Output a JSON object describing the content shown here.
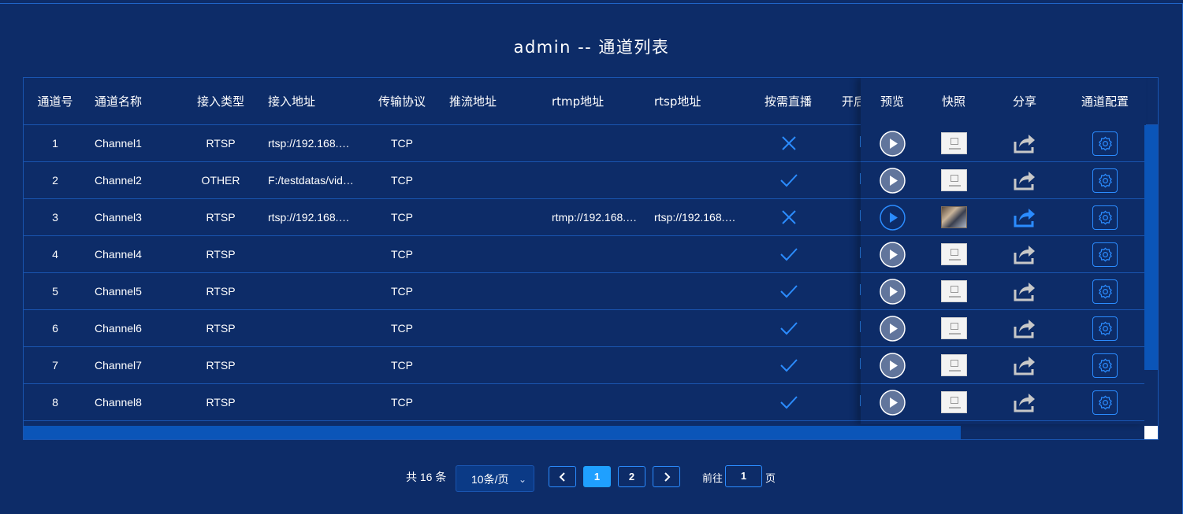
{
  "title": "admin -- 通道列表",
  "columns": {
    "channel_no": "通道号",
    "channel_name": "通道名称",
    "access_type": "接入类型",
    "access_addr": "接入地址",
    "protocol": "传输协议",
    "push_addr": "推流地址",
    "rtmp_addr": "rtmp地址",
    "rtsp_addr": "rtsp地址",
    "on_demand": "按需直播",
    "enable_partial": "开后",
    "preview": "预览",
    "snapshot": "快照",
    "share": "分享",
    "config": "通道配置"
  },
  "rows": [
    {
      "no": "1",
      "name": "Channel1",
      "type": "RTSP",
      "addr": "rtsp://192.168.…",
      "proto": "TCP",
      "push": "",
      "rtmp": "",
      "rtsp": "",
      "on_demand": false,
      "live": false
    },
    {
      "no": "2",
      "name": "Channel2",
      "type": "OTHER",
      "addr": "F:/testdatas/vid…",
      "proto": "TCP",
      "push": "",
      "rtmp": "",
      "rtsp": "",
      "on_demand": true,
      "live": false
    },
    {
      "no": "3",
      "name": "Channel3",
      "type": "RTSP",
      "addr": "rtsp://192.168.…",
      "proto": "TCP",
      "push": "",
      "rtmp": "rtmp://192.168.…",
      "rtsp": "rtsp://192.168.…",
      "on_demand": false,
      "live": true
    },
    {
      "no": "4",
      "name": "Channel4",
      "type": "RTSP",
      "addr": "",
      "proto": "TCP",
      "push": "",
      "rtmp": "",
      "rtsp": "",
      "on_demand": true,
      "live": false
    },
    {
      "no": "5",
      "name": "Channel5",
      "type": "RTSP",
      "addr": "",
      "proto": "TCP",
      "push": "",
      "rtmp": "",
      "rtsp": "",
      "on_demand": true,
      "live": false
    },
    {
      "no": "6",
      "name": "Channel6",
      "type": "RTSP",
      "addr": "",
      "proto": "TCP",
      "push": "",
      "rtmp": "",
      "rtsp": "",
      "on_demand": true,
      "live": false
    },
    {
      "no": "7",
      "name": "Channel7",
      "type": "RTSP",
      "addr": "",
      "proto": "TCP",
      "push": "",
      "rtmp": "",
      "rtsp": "",
      "on_demand": true,
      "live": false
    },
    {
      "no": "8",
      "name": "Channel8",
      "type": "RTSP",
      "addr": "",
      "proto": "TCP",
      "push": "",
      "rtmp": "",
      "rtsp": "",
      "on_demand": true,
      "live": false
    }
  ],
  "pagination": {
    "total_label": "共 16 条",
    "page_size": "10条/页",
    "pages": [
      "1",
      "2"
    ],
    "current_page": "1",
    "goto_label": "前往",
    "goto_value": "1",
    "goto_suffix": "页"
  },
  "colors": {
    "background": "#0d2c68",
    "border": "#1a55b0",
    "accent": "#2b8cff",
    "active_page": "#1fa0ff",
    "scrollbar": "#0b55b8"
  },
  "icons": {
    "on_demand_true": "check-icon",
    "on_demand_false": "cross-icon",
    "preview": "play-circle-icon",
    "snapshot": "image-thumbnail",
    "share": "share-icon",
    "config": "gear-icon"
  }
}
